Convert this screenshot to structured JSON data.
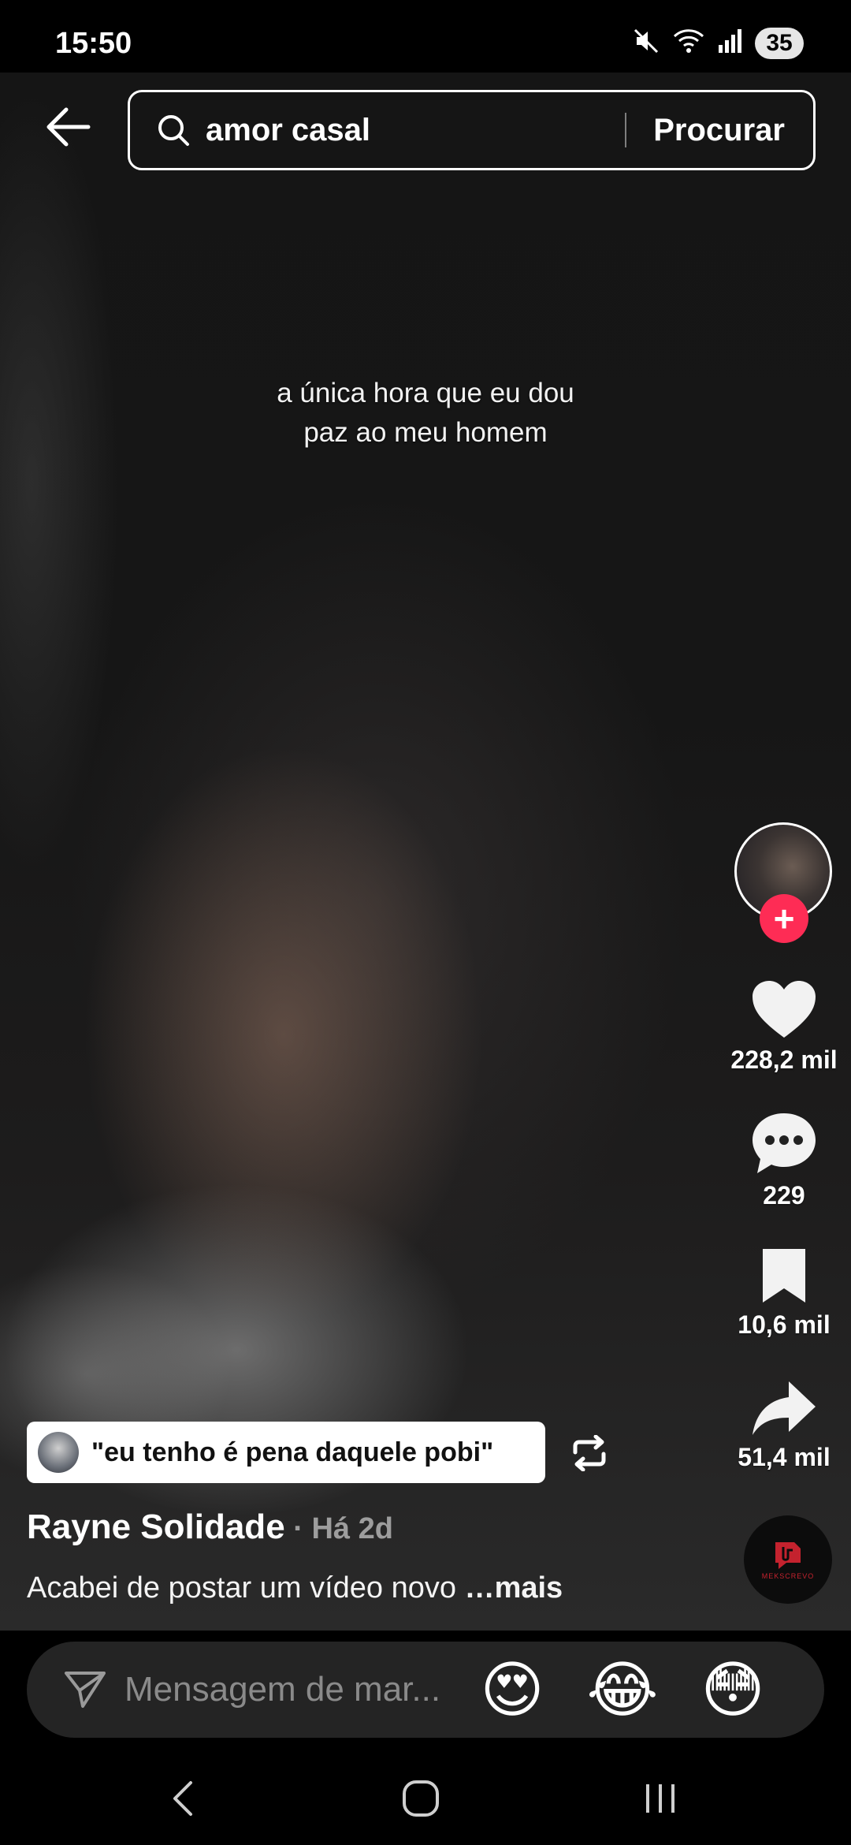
{
  "status_bar": {
    "time": "15:50",
    "battery": "35",
    "icons": [
      "mute-icon",
      "wifi-icon",
      "signal-icon",
      "battery-icon"
    ]
  },
  "search": {
    "query": "amor casal",
    "button_label": "Procurar",
    "icons": [
      "back-arrow-icon",
      "search-icon"
    ]
  },
  "video": {
    "overlay_text_line1": "a única hora que eu dou",
    "overlay_text_line2": "paz ao meu homem"
  },
  "actions": {
    "likes": "228,2 mil",
    "comments": "229",
    "saves": "10,6 mil",
    "shares": "51,4 mil",
    "follow_icon": "plus-icon"
  },
  "sound": {
    "title": "\"eu tenho é pena daquele pobi\""
  },
  "post": {
    "author": "Rayne Solidade",
    "time": " · Há 2d",
    "description": "Acabei de postar um vídeo novo ",
    "more": "…mais"
  },
  "comment_bar": {
    "placeholder": "Mensagem de mar...",
    "emojis": [
      "😍",
      "😂",
      "😳"
    ]
  },
  "colors": {
    "accent": "#fe2c55",
    "background": "#000000",
    "comment_bar": "#242424"
  }
}
